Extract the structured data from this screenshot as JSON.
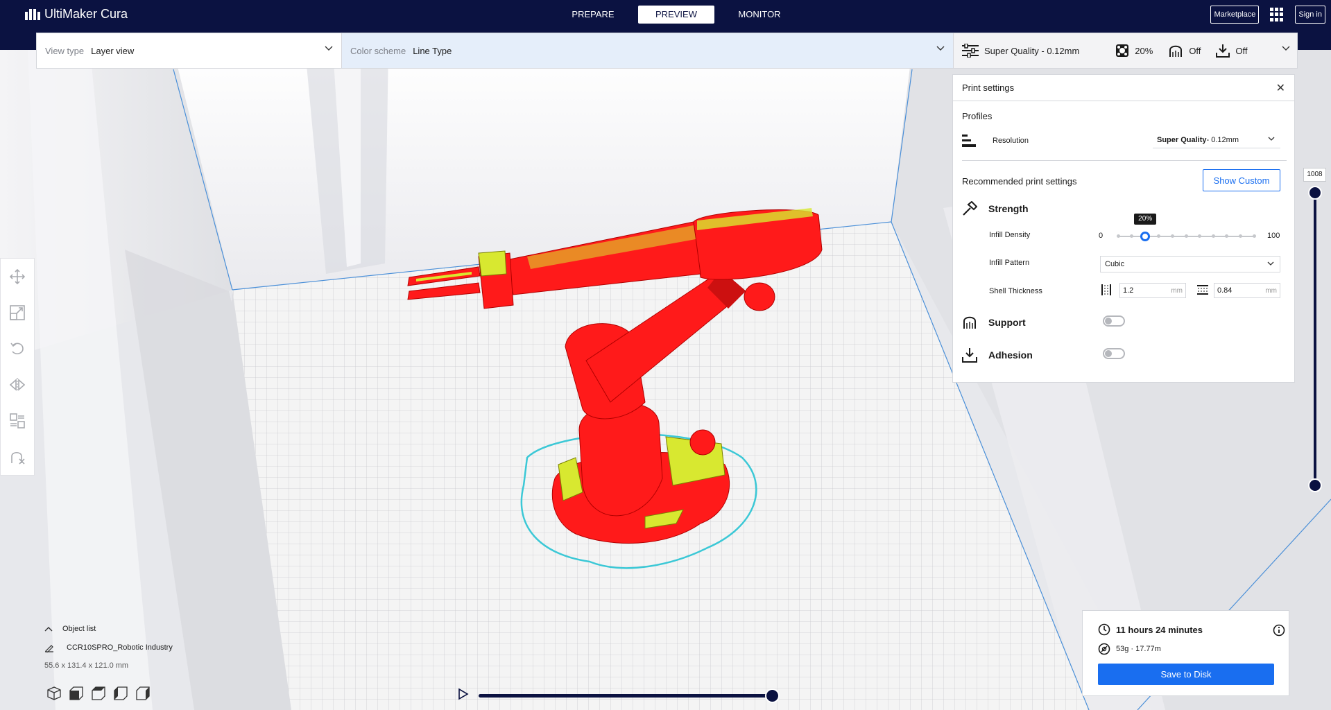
{
  "app": {
    "name": "UltiMaker Cura",
    "tabs": [
      "PREPARE",
      "PREVIEW",
      "MONITOR"
    ],
    "active_tab": "PREVIEW",
    "marketplace_label": "Marketplace",
    "signin_label": "Sign in"
  },
  "header": {
    "view_type_label": "View type",
    "view_type_value": "Layer view",
    "color_scheme_label": "Color scheme",
    "color_scheme_value": "Line Type",
    "profile_summary": "Super Quality - 0.12mm",
    "infill_summary": "20%",
    "support_summary": "Off",
    "adhesion_summary": "Off"
  },
  "print_settings": {
    "title": "Print settings",
    "profiles_label": "Profiles",
    "resolution_label": "Resolution",
    "resolution_value_bold": "Super Quality",
    "resolution_value_rest": " - 0.12mm",
    "recommended_label": "Recommended print settings",
    "show_custom_label": "Show Custom",
    "strength_label": "Strength",
    "infill_density_label": "Infill Density",
    "infill_min": "0",
    "infill_max": "100",
    "infill_value_label": "20%",
    "infill_value": 20,
    "infill_pattern_label": "Infill Pattern",
    "infill_pattern_value": "Cubic",
    "shell_thickness_label": "Shell Thickness",
    "wall_thickness": "1.2",
    "top_bottom_thickness": "0.84",
    "unit_mm": "mm",
    "support_label": "Support",
    "support_on": false,
    "adhesion_label": "Adhesion",
    "adhesion_on": false
  },
  "layer_slider": {
    "current_layer": "1008"
  },
  "object_list": {
    "title": "Object list",
    "object_name": "CCR10SPRO_Robotic Industry",
    "dimensions": "55.6 x 131.4 x 121.0 mm"
  },
  "estimate": {
    "print_time": "11 hours 24 minutes",
    "material": "53g · 17.77m",
    "save_label": "Save to Disk"
  },
  "colors": {
    "navy": "#0b1241",
    "accent_blue": "#196ef0",
    "model_red": "#ff1a1a",
    "model_yellow": "#d8e830",
    "skirt_cyan": "#3bc8d6"
  }
}
